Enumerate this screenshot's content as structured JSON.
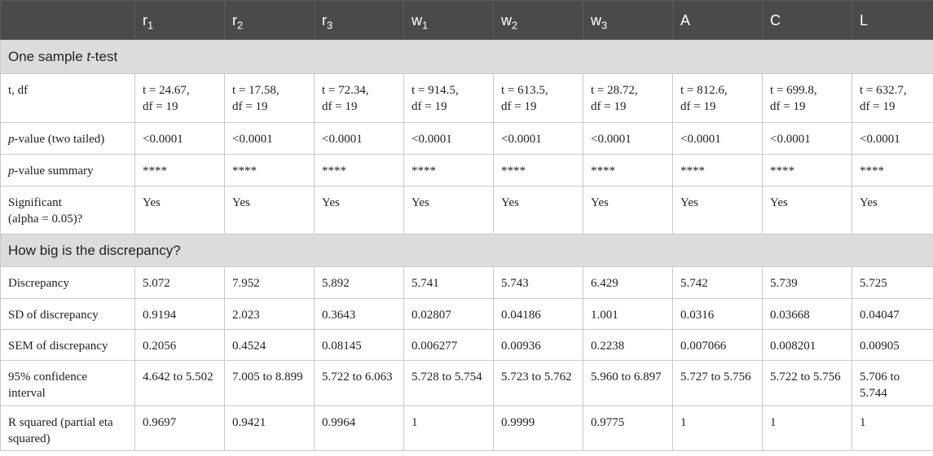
{
  "header": {
    "corner": "",
    "columns": [
      {
        "base": "r",
        "sub": "1"
      },
      {
        "base": "r",
        "sub": "2"
      },
      {
        "base": "r",
        "sub": "3"
      },
      {
        "base": "w",
        "sub": "1"
      },
      {
        "base": "w",
        "sub": "2"
      },
      {
        "base": "w",
        "sub": "3"
      },
      {
        "base": "A",
        "sub": ""
      },
      {
        "base": "C",
        "sub": ""
      },
      {
        "base": "L",
        "sub": ""
      }
    ]
  },
  "section1": {
    "pre": "One sample ",
    "italic": "t",
    "post": "-test"
  },
  "t_df": {
    "label": "t, df",
    "t_values": [
      "t = 24.67,",
      "t = 17.58,",
      "t = 72.34,",
      "t = 914.5,",
      "t = 613.5,",
      "t = 28.72,",
      "t = 812.6,",
      "t = 699.8,",
      "t = 632.7,"
    ],
    "df_values": [
      "df = 19",
      "df = 19",
      "df = 19",
      "df = 19",
      "df = 19",
      "df = 19",
      "df = 19",
      "df = 19",
      "df = 19"
    ]
  },
  "p_value": {
    "label_italic": "p",
    "label_rest": "-value (two tailed)",
    "values": [
      "<0.0001",
      "<0.0001",
      "<0.0001",
      "<0.0001",
      "<0.0001",
      "<0.0001",
      "<0.0001",
      "<0.0001",
      "<0.0001"
    ]
  },
  "p_summary": {
    "label_italic": "p",
    "label_rest": "-value summary",
    "values": [
      "****",
      "****",
      "****",
      "****",
      "****",
      "****",
      "****",
      "****",
      "****"
    ]
  },
  "significant": {
    "label_line1": "Significant",
    "label_line2": "(alpha = 0.05)?",
    "values": [
      "Yes",
      "Yes",
      "Yes",
      "Yes",
      "Yes",
      "Yes",
      "Yes",
      "Yes",
      "Yes"
    ]
  },
  "section2": {
    "label": "How big is the discrepancy?"
  },
  "discrepancy": {
    "label": "Discrepancy",
    "values": [
      "5.072",
      "7.952",
      "5.892",
      "5.741",
      "5.743",
      "6.429",
      "5.742",
      "5.739",
      "5.725"
    ]
  },
  "sd": {
    "label": "SD of discrepancy",
    "values": [
      "0.9194",
      "2.023",
      "0.3643",
      "0.02807",
      "0.04186",
      "1.001",
      "0.0316",
      "0.03668",
      "0.04047"
    ]
  },
  "sem": {
    "label": "SEM of discrepancy",
    "values": [
      "0.2056",
      "0.4524",
      "0.08145",
      "0.006277",
      "0.00936",
      "0.2238",
      "0.007066",
      "0.008201",
      "0.00905"
    ]
  },
  "ci": {
    "label_line1": "95% confidence",
    "label_line2": "interval",
    "values": [
      "4.642 to 5.502",
      "7.005 to 8.899",
      "5.722 to 6.063",
      "5.728 to 5.754",
      "5.723 to 5.762",
      "5.960 to 6.897",
      "5.727 to 5.756",
      "5.722 to 5.756",
      "5.706 to 5.744"
    ]
  },
  "r_squared": {
    "label_line1": "R squared (partial eta",
    "label_line2": "squared)",
    "values": [
      "0.9697",
      "0.9421",
      "0.9964",
      "1",
      "0.9999",
      "0.9775",
      "1",
      "1",
      "1"
    ]
  }
}
